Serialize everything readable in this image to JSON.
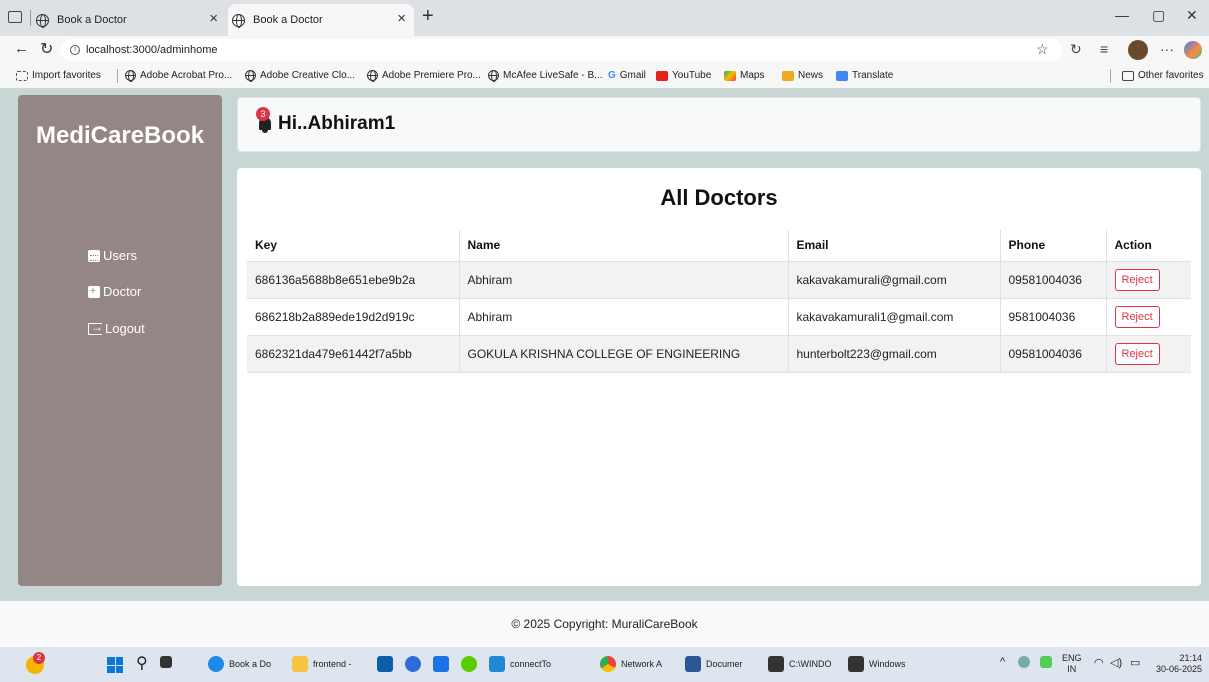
{
  "browser": {
    "tabs": [
      {
        "title": "Book a Doctor"
      },
      {
        "title": "Book a Doctor"
      }
    ],
    "url": "localhost:3000/adminhome",
    "favorites": [
      "Import favorites",
      "Adobe Acrobat Pro...",
      "Adobe Creative Clo...",
      "Adobe Premiere Pro...",
      "McAfee LiveSafe - B...",
      "Gmail",
      "YouTube",
      "Maps",
      "News",
      "Translate"
    ],
    "other_favorites": "Other favorites"
  },
  "app": {
    "brand": "MediCareBook",
    "greeting": "Hi..Abhiram1",
    "notification_count": "3",
    "nav": [
      {
        "label": "Users",
        "icon": "calendar-icon"
      },
      {
        "label": "Doctor",
        "icon": "doctor-icon"
      },
      {
        "label": "Logout",
        "icon": "logout-icon"
      }
    ]
  },
  "main": {
    "title": "All Doctors",
    "columns": [
      "Key",
      "Name",
      "Email",
      "Phone",
      "Action"
    ],
    "rows": [
      {
        "key": "686136a5688b8e651ebe9b2a",
        "name": "Abhiram",
        "email": "kakavakamurali@gmail.com",
        "phone": "09581004036",
        "action": "Reject"
      },
      {
        "key": "686218b2a889ede19d2d919c",
        "name": "Abhiram",
        "email": "kakavakamurali1@gmail.com",
        "phone": "9581004036",
        "action": "Reject"
      },
      {
        "key": "6862321da479e61442f7a5bb",
        "name": "GOKULA KRISHNA COLLEGE OF ENGINEERING",
        "email": "hunterbolt223@gmail.com",
        "phone": "09581004036",
        "action": "Reject"
      }
    ]
  },
  "footer": {
    "text": "© 2025 Copyright: MuraliCareBook"
  },
  "taskbar": {
    "weather_badge": "2",
    "apps": [
      "Book a Do",
      "frontend -",
      "connectTo",
      "Network A",
      "Documer",
      "C:\\WINDO",
      "Windows"
    ],
    "lang_top": "ENG",
    "lang_bottom": "IN",
    "time": "21:14",
    "date": "30-06-2025"
  }
}
